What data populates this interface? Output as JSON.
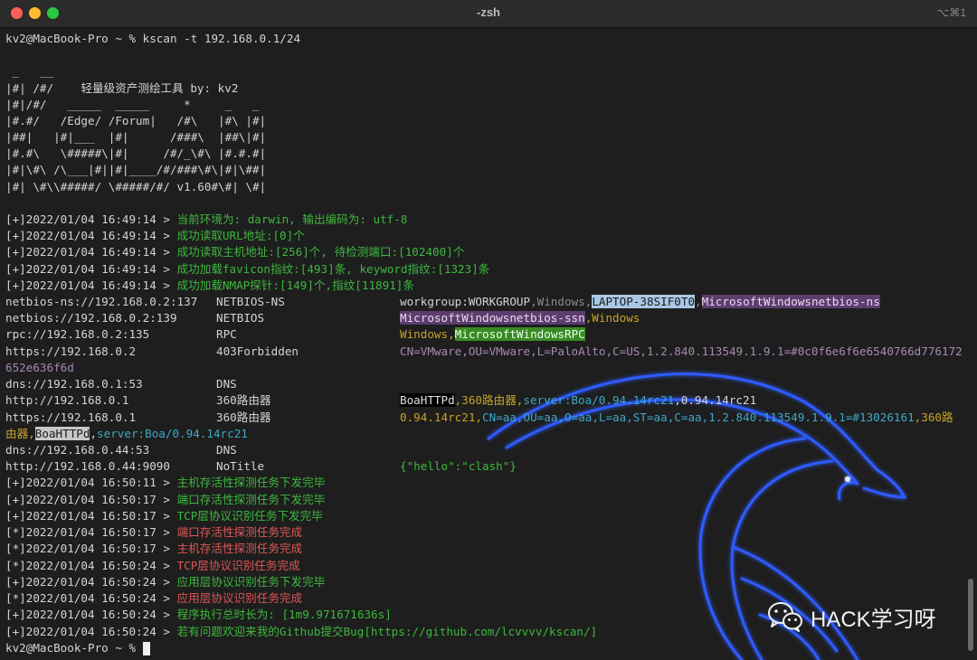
{
  "window": {
    "title": "-zsh",
    "shortcut": "⌥⌘1"
  },
  "terminal": {
    "command_line": "kv2@MacBook-Pro ~ % kscan -t 192.168.0.1/24",
    "banner": [
      " _   __",
      "|#| /#/    轻量级资产测绘工具 by: kv2",
      "|#|/#/   _____  _____     *     _   _",
      "|#.#/   /Edge/ /Forum|   /#\\   |#\\ |#|",
      "|##|   |#|___  |#|      /###\\  |##\\|#|",
      "|#.#\\   \\#####\\|#|     /#/_\\#\\ |#.#.#|",
      "|#|\\#\\ /\\___|#||#|____/#/###\\#\\|#|\\##|",
      "|#| \\#\\\\#####/ \\#####/#/ v1.60#\\#| \\#|"
    ],
    "logs_start": [
      {
        "prefix": "[+]2022/01/04 16:49:14 > ",
        "msg": "当前环境为: darwin, 输出编码为: utf-8"
      },
      {
        "prefix": "[+]2022/01/04 16:49:14 > ",
        "msg": "成功读取URL地址:[0]个"
      },
      {
        "prefix": "[+]2022/01/04 16:49:14 > ",
        "msg": "成功读取主机地址:[256]个, 待检测端口:[102400]个"
      },
      {
        "prefix": "[+]2022/01/04 16:49:14 > ",
        "msg": "成功加载favicon指纹:[493]条, keyword指纹:[1323]条"
      },
      {
        "prefix": "[+]2022/01/04 16:49:14 > ",
        "msg": "成功加载NMAP探针:[149]个,指纹[11891]条"
      }
    ],
    "results": [
      {
        "target": "netbios-ns://192.168.0.2:137",
        "service": "NETBIOS-NS"
      },
      {
        "target": "netbios://192.168.0.2:139",
        "service": "NETBIOS"
      },
      {
        "target": "rpc://192.168.0.2:135",
        "service": "RPC"
      },
      {
        "target": "https://192.168.0.2",
        "service": "403Forbidden"
      },
      {
        "target": "dns://192.168.0.1:53",
        "service": "DNS"
      },
      {
        "target": "http://192.168.0.1",
        "service": "360路由器"
      },
      {
        "target": "https://192.168.0.1",
        "service": "360路由器"
      },
      {
        "target": "dns://192.168.0.44:53",
        "service": "DNS"
      },
      {
        "target": "http://192.168.0.44:9090",
        "service": "NoTitle"
      }
    ],
    "details": {
      "r1_a": "workgroup:WORKGROUP",
      "r1_b": ",Windows,",
      "r1_c": "LAPTOP-38SIF0T0",
      "r1_d": ",",
      "r1_e": "MicrosoftWindowsnetbios-ns",
      "r2_a": "MicrosoftWindowsnetbios-ssn",
      "r2_b": ",Windows",
      "r3_a": "Windows,",
      "r3_b": "MicrosoftWindowsRPC",
      "r4_a": "CN=VMware,OU=VMware,L=PaloAlto,C=US,1.2.840.113549.1.9.1=#0c0f6e6f6e6540766d776172",
      "r4_wrap": "652e636f6d",
      "r6_a": "BoaHTTPd",
      "r6_b": ",360路由器,",
      "r6_c": "server:Boa/0.94.14rc21",
      "r6_d": ",0.94.14rc21",
      "r7_a": "0.94.14rc21,",
      "r7_b": "CN=aa,OU=aa,O=aa,L=aa,ST=aa,C=aa,1.2.840.113549.1.9.1=#13026161",
      "r7_c": ",360路",
      "r7_wrap_a": "由器,",
      "r7_wrap_b": "BoaHTTPd",
      "r7_wrap_c": ",",
      "r7_wrap_d": "server:Boa/0.94.14rc21",
      "r9_a": "{\"hello\":\"clash\"}"
    },
    "logs_end": [
      {
        "prefix": "[+]2022/01/04 16:50:11 > ",
        "msg": "主机存活性探测任务下发完毕",
        "color": "g"
      },
      {
        "prefix": "[+]2022/01/04 16:50:17 > ",
        "msg": "端口存活性探测任务下发完毕",
        "color": "g"
      },
      {
        "prefix": "[+]2022/01/04 16:50:17 > ",
        "msg": "TCP层协议识别任务下发完毕",
        "color": "g"
      },
      {
        "prefix": "[*]2022/01/04 16:50:17 > ",
        "msg": "端口存活性探测任务完成",
        "color": "r"
      },
      {
        "prefix": "[*]2022/01/04 16:50:17 > ",
        "msg": "主机存活性探测任务完成",
        "color": "r"
      },
      {
        "prefix": "[*]2022/01/04 16:50:24 > ",
        "msg": "TCP层协议识别任务完成",
        "color": "r"
      },
      {
        "prefix": "[+]2022/01/04 16:50:24 > ",
        "msg": "应用层协议识别任务下发完毕",
        "color": "g"
      },
      {
        "prefix": "[*]2022/01/04 16:50:24 > ",
        "msg": "应用层协议识别任务完成",
        "color": "r"
      },
      {
        "prefix": "[+]2022/01/04 16:50:24 > ",
        "msg": "程序执行总时长为: [1m9.971671636s]",
        "color": "g"
      },
      {
        "prefix": "[+]2022/01/04 16:50:24 > ",
        "msg": "若有问题欢迎来我的Github提交Bug[https://github.com/lcvvvv/kscan/]",
        "color": "g"
      }
    ],
    "prompt": "kv2@MacBook-Pro ~ % "
  },
  "watermark": {
    "text": "HACK学习呀",
    "icon": "wechat-icon"
  },
  "colors": {
    "success": "#3db83d",
    "complete": "#e05555",
    "dragon_glow": "#2f5bff"
  }
}
